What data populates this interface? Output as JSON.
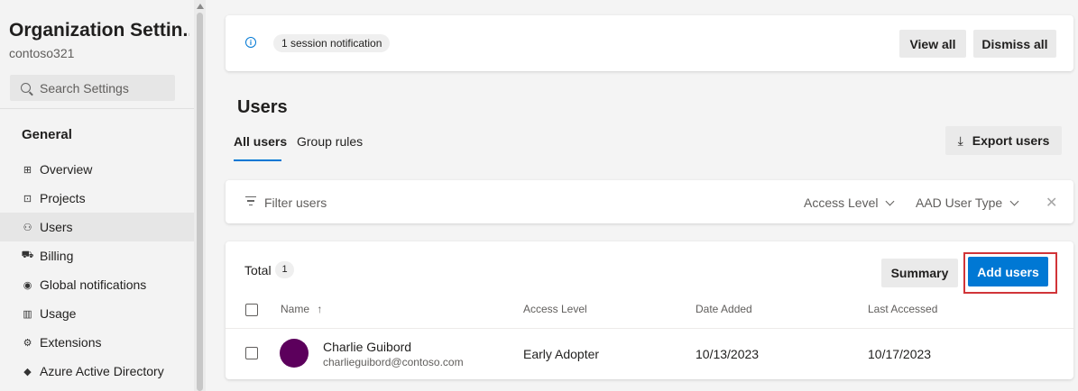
{
  "sidebar": {
    "org_title": "Organization Settin...",
    "org_subtitle": "contoso321",
    "search_placeholder": "Search Settings",
    "section_title": "General",
    "items": [
      {
        "label": "Overview",
        "icon": "overview-icon",
        "active": false
      },
      {
        "label": "Projects",
        "icon": "projects-icon",
        "active": false
      },
      {
        "label": "Users",
        "icon": "users-icon",
        "active": true
      },
      {
        "label": "Billing",
        "icon": "billing-icon",
        "active": false
      },
      {
        "label": "Global notifications",
        "icon": "notifications-icon",
        "active": false
      },
      {
        "label": "Usage",
        "icon": "usage-icon",
        "active": false
      },
      {
        "label": "Extensions",
        "icon": "extensions-icon",
        "active": false
      },
      {
        "label": "Azure Active Directory",
        "icon": "azure-ad-icon",
        "active": false
      }
    ]
  },
  "notification": {
    "pill": "1 session notification",
    "view_all": "View all",
    "dismiss_all": "Dismiss all"
  },
  "page": {
    "title": "Users",
    "tabs": [
      "All users",
      "Group rules"
    ],
    "active_tab": "All users",
    "export_label": "Export users"
  },
  "filter": {
    "placeholder": "Filter users",
    "access_level": "Access Level",
    "aad_user_type": "AAD User Type"
  },
  "users": {
    "total_label": "Total",
    "total_count": "1",
    "summary_label": "Summary",
    "add_label": "Add users",
    "columns": {
      "name": "Name",
      "sort_indicator": "↑",
      "access_level": "Access Level",
      "date_added": "Date Added",
      "last_accessed": "Last Accessed"
    },
    "rows": [
      {
        "name": "Charlie Guibord",
        "email": "charlieguibord@contoso.com",
        "access_level": "Early Adopter",
        "date_added": "10/13/2023",
        "last_accessed": "10/17/2023"
      }
    ]
  },
  "colors": {
    "accent": "#0078d4",
    "highlight_outline": "#d13438",
    "avatar": "#5c005c"
  }
}
